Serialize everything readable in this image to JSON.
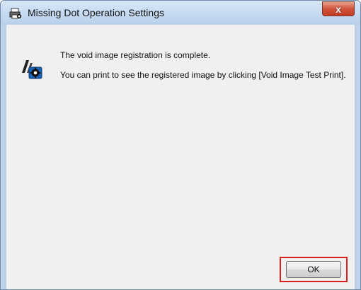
{
  "window": {
    "title": "Missing Dot Operation Settings",
    "title_icon": "printer-gear-icon",
    "close_label": "x"
  },
  "message": {
    "icon": "printer-gear-icon",
    "line1": "The void image registration is complete.",
    "line2": "You can print to see the registered image by clicking [Void Image Test Print]."
  },
  "buttons": {
    "ok_label": "OK"
  },
  "colors": {
    "highlight": "#d92020",
    "close_button": "#c23a22",
    "titlebar": "#c8dcf2"
  }
}
